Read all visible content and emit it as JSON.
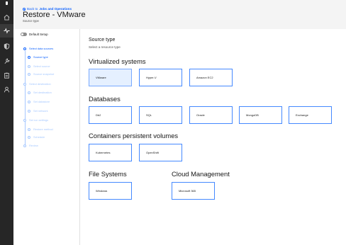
{
  "header": {
    "back_prefix": "Back to",
    "back_target": "Jobs and Operations",
    "title": "Restore - VMware",
    "subtitle": "Source type"
  },
  "nav": {
    "items": [
      {
        "icon": "activity-icon"
      },
      {
        "icon": "shield-icon"
      },
      {
        "icon": "wrench-icon"
      },
      {
        "icon": "clipboard-icon"
      },
      {
        "icon": "user-icon"
      }
    ]
  },
  "progress": {
    "toggle_label": "Default Setup",
    "steps": [
      {
        "label": "Select data sources",
        "state": "major"
      },
      {
        "label": "Source type",
        "state": "current"
      },
      {
        "label": "Select source",
        "state": "dim"
      },
      {
        "label": "Source snapshot",
        "state": "dim"
      },
      {
        "label": "Select destination",
        "state": "dim"
      },
      {
        "label": "Set destination",
        "state": "dim"
      },
      {
        "label": "Set datastore",
        "state": "dim"
      },
      {
        "label": "Set network",
        "state": "dim"
      },
      {
        "label": "Set run settings",
        "state": "dim"
      },
      {
        "label": "Restore method",
        "state": "dim"
      },
      {
        "label": "Schedule",
        "state": "dim"
      },
      {
        "label": "Review",
        "state": "dim"
      }
    ]
  },
  "main": {
    "heading": "Source type",
    "subheading": "Select a resource type",
    "groups": {
      "virtualized": {
        "title": "Virtualized systems",
        "tiles": [
          "VMware",
          "Hyper-V",
          "Amazon EC2"
        ],
        "selected": "VMware"
      },
      "databases": {
        "title": "Databases",
        "tiles": [
          "Db2",
          "SQL",
          "Oracle",
          "MongoDB",
          "Exchange"
        ]
      },
      "containers": {
        "title": "Containers persistent volumes",
        "tiles": [
          "Kubernetes",
          "OpenShift"
        ]
      },
      "filesystems": {
        "title": "File Systems",
        "tiles": [
          "Windows"
        ]
      },
      "cloud": {
        "title": "Cloud Management",
        "tiles": [
          "Microsoft 365"
        ]
      }
    }
  },
  "colors": {
    "accent": "#0f62fe",
    "nav_bg": "#262626",
    "header_bg": "#f4f4f4",
    "tile_border": "#4589ff",
    "tile_selected_bg": "#e5f0ff",
    "step_dim": "#a6c8ff"
  }
}
